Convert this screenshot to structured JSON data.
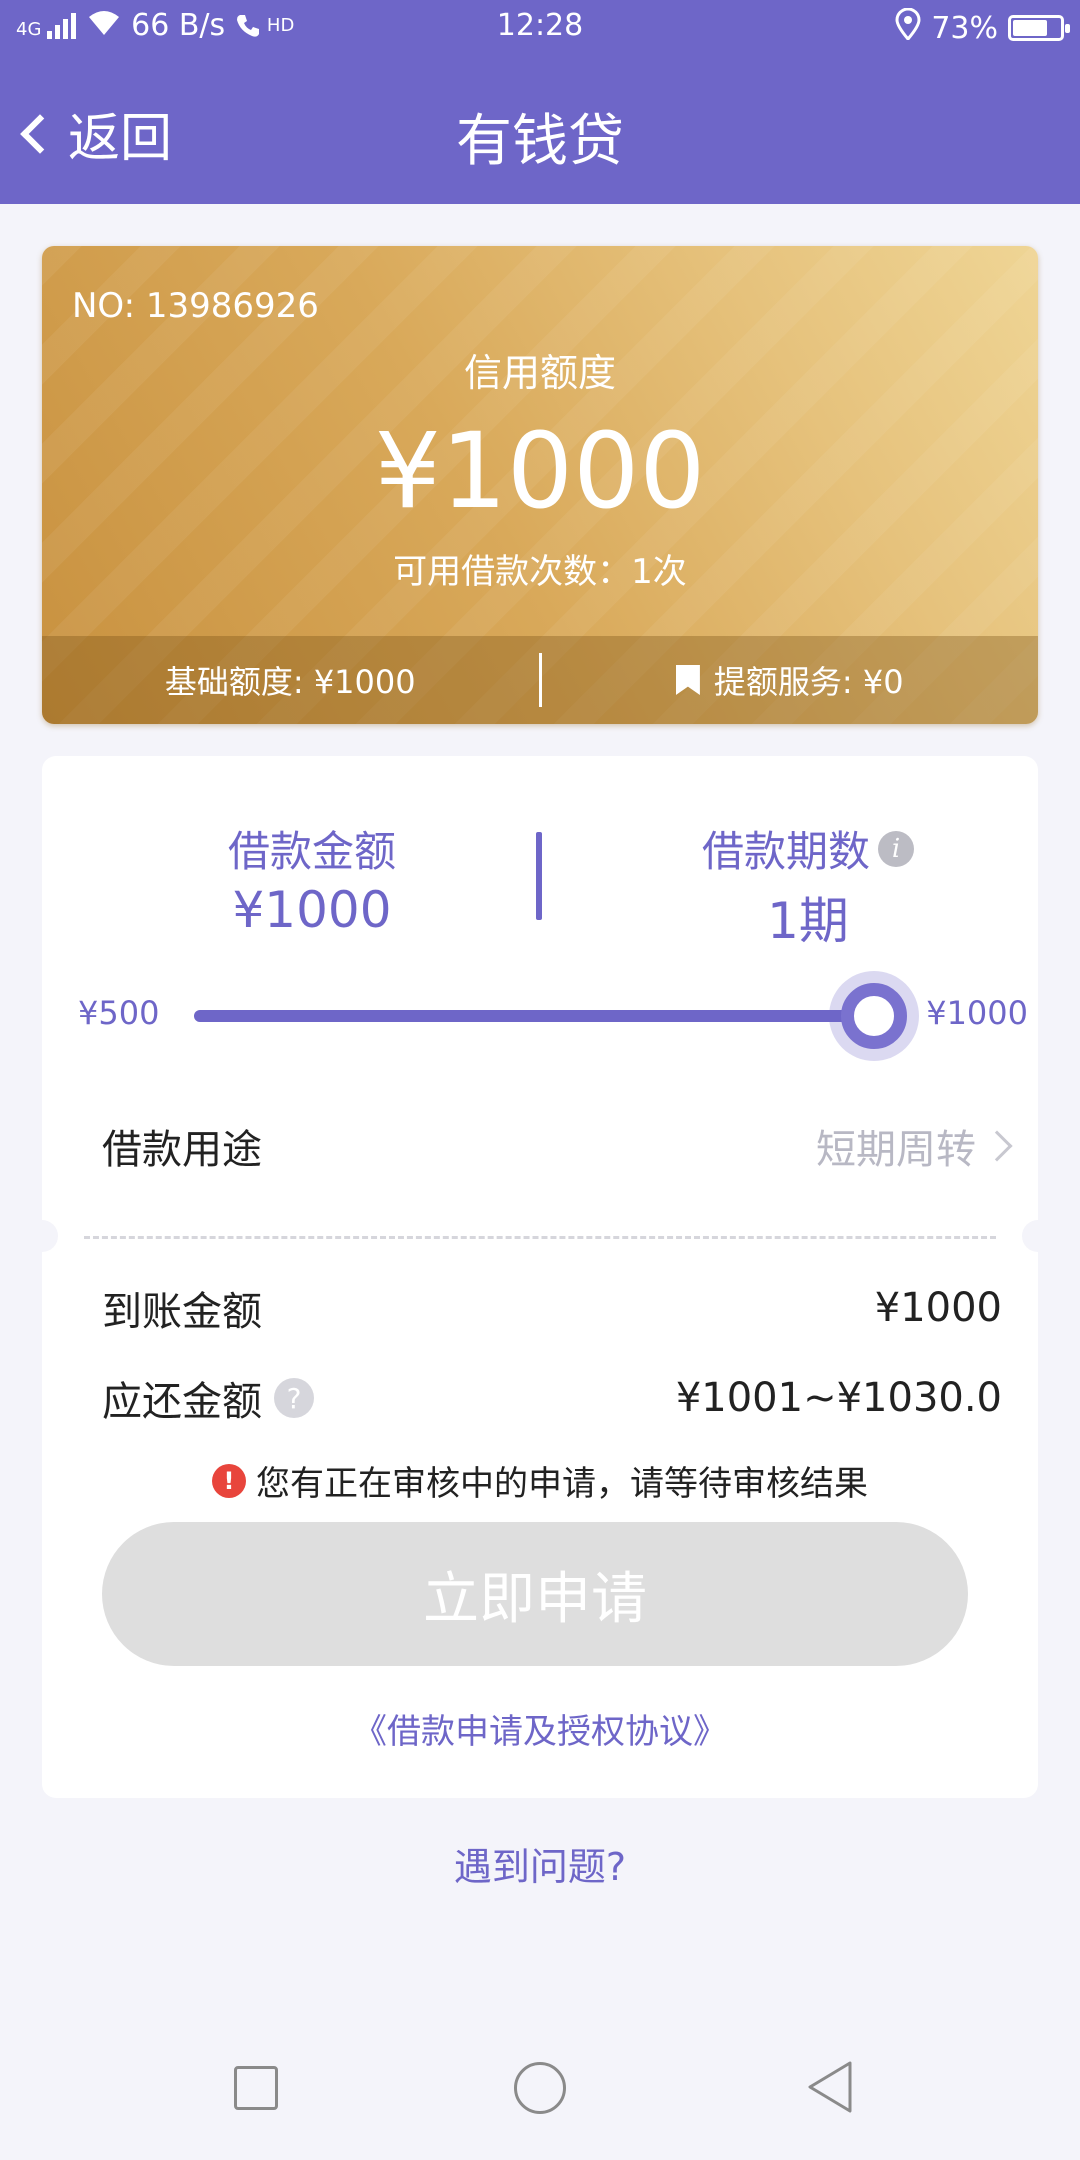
{
  "status_bar": {
    "network": "4G",
    "speed": "66 B/s",
    "hd": "HD",
    "time": "12:28",
    "battery": "73%",
    "battery_level": 0.73
  },
  "nav": {
    "back_label": "返回",
    "title": "有钱贷"
  },
  "credit_card": {
    "number": "NO: 13986926",
    "label": "信用额度",
    "amount": "¥1000",
    "available_times": "可用借款次数：1次",
    "base_quota": "基础额度: ¥1000",
    "boost_service": "提额服务: ¥0",
    "colors": {
      "gold_start": "#c8913f",
      "gold_end": "#efd595"
    }
  },
  "loan": {
    "amount_label": "借款金额",
    "amount_value": "¥1000",
    "term_label": "借款期数",
    "term_value": "1期",
    "slider_min": "¥500",
    "slider_max": "¥1000",
    "slider_fraction": 1.0,
    "purpose_label": "借款用途",
    "purpose_value": "短期周转",
    "received_label": "到账金额",
    "received_value": "¥1000",
    "due_label": "应还金额",
    "due_value": "¥1001~¥1030.0",
    "warning": "您有正在审核中的申请，请等待审核结果",
    "apply_button": "立即申请",
    "agreement": "《借款申请及授权协议》"
  },
  "help_link": "遇到问题?",
  "accent_color": "#6e66c8"
}
